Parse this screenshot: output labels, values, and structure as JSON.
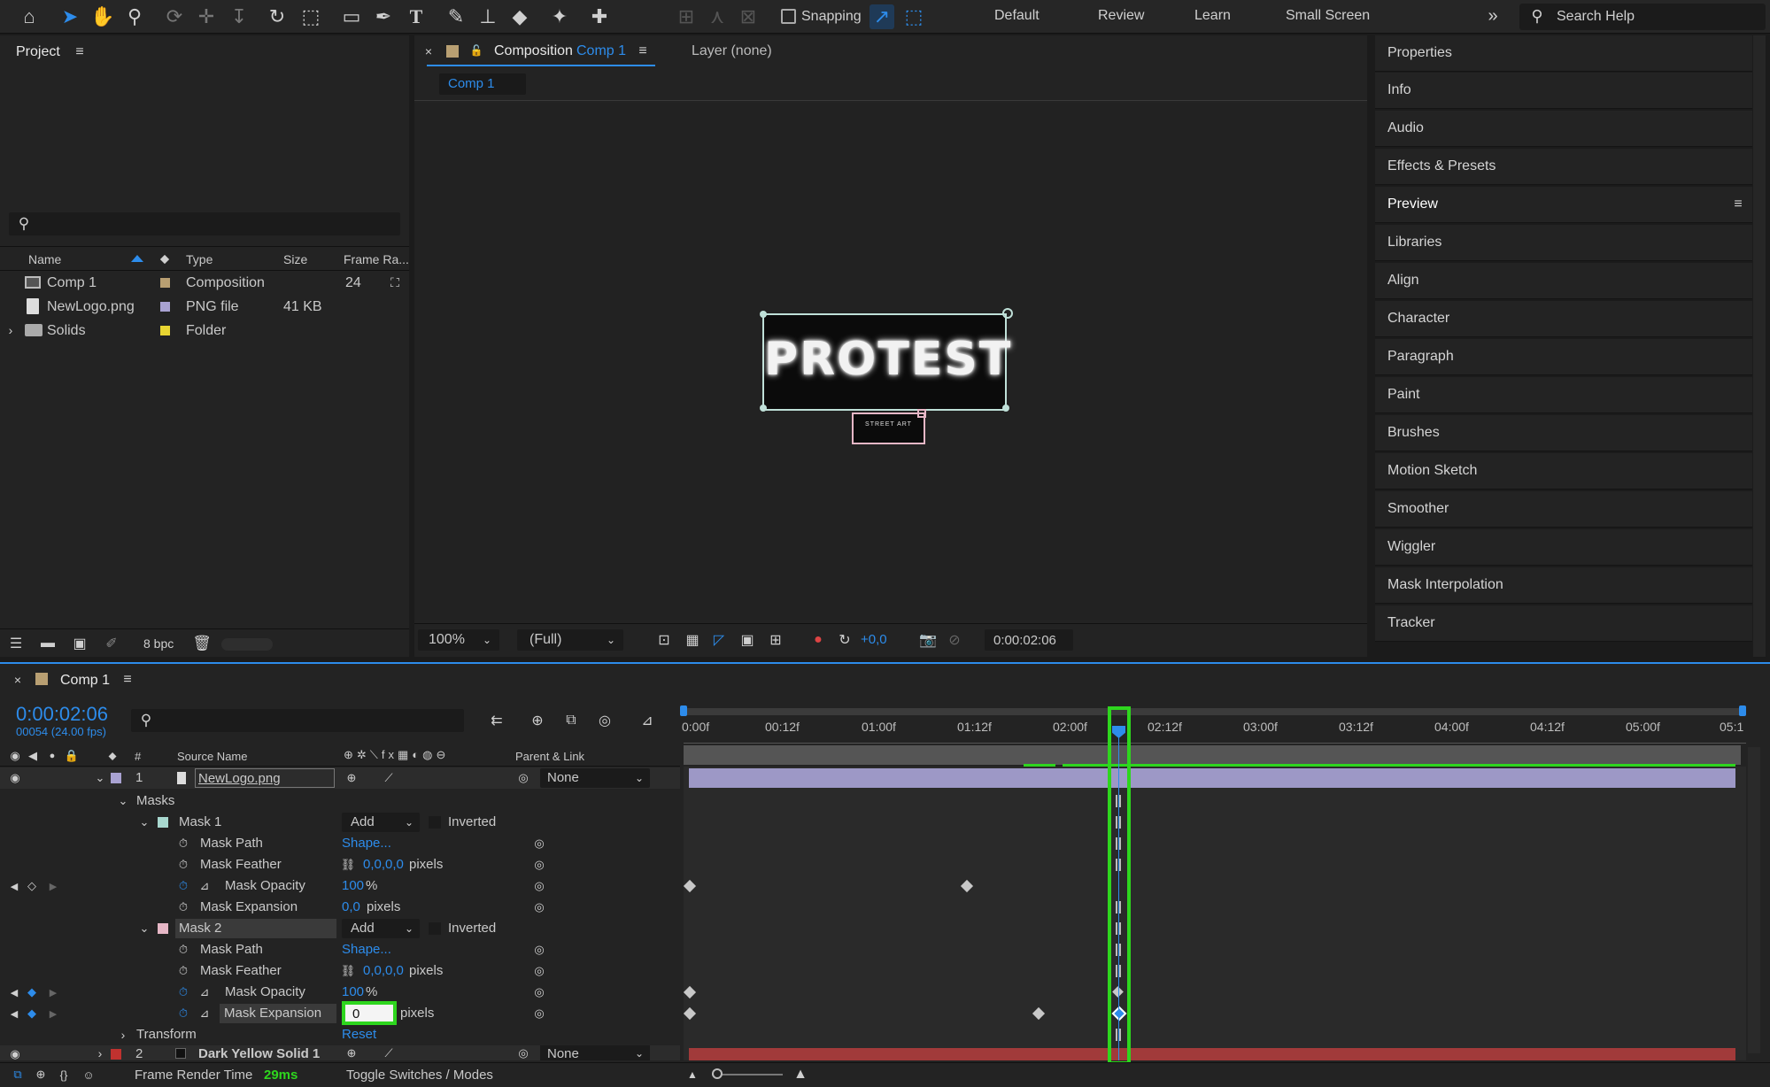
{
  "toolbar": {
    "snapping_label": "Snapping",
    "workspaces": [
      "Default",
      "Review",
      "Learn",
      "Small Screen"
    ],
    "search_placeholder": "Search Help"
  },
  "project": {
    "title": "Project",
    "search_placeholder": "",
    "columns": {
      "name": "Name",
      "type": "Type",
      "size": "Size",
      "frame_rate": "Frame Ra..."
    },
    "items": [
      {
        "name": "Comp 1",
        "type": "Composition",
        "size": "",
        "frame_rate": "24",
        "label_color": "#b89f72"
      },
      {
        "name": "NewLogo.png",
        "type": "PNG file",
        "size": "41 KB",
        "frame_rate": "",
        "label_color": "#a9a2d2"
      },
      {
        "name": "Solids",
        "type": "Folder",
        "size": "",
        "frame_rate": "",
        "label_color": "#e8d532"
      }
    ],
    "bpc": "8 bpc"
  },
  "composition": {
    "tab_prefix": "Composition",
    "tab_name": "Comp 1",
    "layer_tab": "Layer (none)",
    "flow_tab": "Comp 1",
    "logo_text": "PROTEST",
    "logo_subtext": "STREET ART",
    "zoom": "100%",
    "resolution": "(Full)",
    "exposure": "+0,0",
    "timecode": "0:00:02:06"
  },
  "right_panels": [
    "Properties",
    "Info",
    "Audio",
    "Effects & Presets",
    "Preview",
    "Libraries",
    "Align",
    "Character",
    "Paragraph",
    "Paint",
    "Brushes",
    "Motion Sketch",
    "Smoother",
    "Wiggler",
    "Mask Interpolation",
    "Tracker"
  ],
  "timeline": {
    "comp_name": "Comp 1",
    "timecode": "0:00:02:06",
    "frame_info": "00054 (24.00 fps)",
    "col_num": "#",
    "col_source": "Source Name",
    "col_parent": "Parent & Link",
    "ruler": [
      "0:00f",
      "00:12f",
      "01:00f",
      "01:12f",
      "02:00f",
      "02:12f",
      "03:00f",
      "03:12f",
      "04:00f",
      "04:12f",
      "05:00f",
      "05:1"
    ],
    "layer1": {
      "num": "1",
      "name": "NewLogo.png",
      "parent": "None"
    },
    "masks_label": "Masks",
    "mask1": {
      "name": "Mask 1",
      "mode": "Add",
      "inverted": "Inverted"
    },
    "mask2": {
      "name": "Mask 2",
      "mode": "Add",
      "inverted": "Inverted"
    },
    "props": {
      "path": "Mask Path",
      "feather": "Mask Feather",
      "opacity": "Mask Opacity",
      "expansion": "Mask Expansion",
      "shape": "Shape...",
      "feather_val": "0,0,0,0",
      "pixels": "pixels",
      "opacity_val": "100",
      "pct": "%",
      "expansion_val1": "0,0",
      "expansion_input": "0"
    },
    "transform": {
      "label": "Transform",
      "reset": "Reset"
    },
    "layer2": {
      "num": "2",
      "name": "Dark Yellow Solid 1",
      "parent": "None"
    },
    "render_label": "Frame Render Time",
    "render_value": "29ms",
    "toggle_label": "Toggle Switches / Modes"
  },
  "colors": {
    "accent": "#2d8ceb",
    "highlight": "#2ed61e",
    "layer_bar": "#9d98c6",
    "solid_bar": "#a13a3a"
  }
}
